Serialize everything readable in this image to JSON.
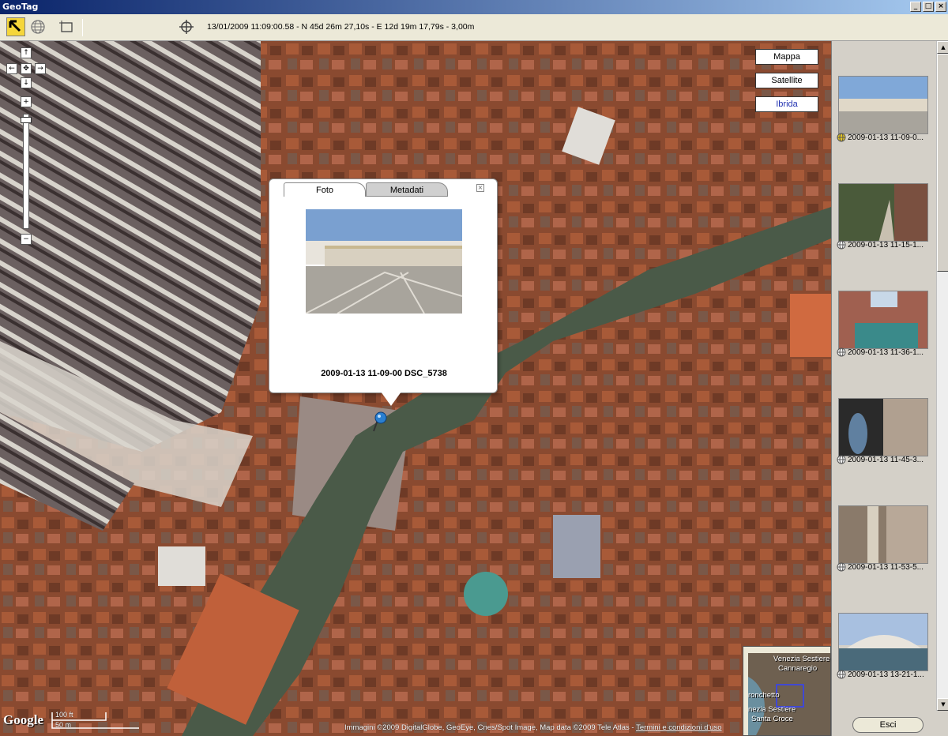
{
  "window": {
    "title": "GeoTag"
  },
  "toolbar": {
    "tools": [
      {
        "name": "select-arrow-icon",
        "active": true
      },
      {
        "name": "globe-icon",
        "active": false
      },
      {
        "name": "frame-icon",
        "active": false
      }
    ],
    "crosshair_icon": "crosshair-icon",
    "coordinates": "13/01/2009 11:09:00.58 - N 45d 26m 27,10s - E 12d 19m 17,79s - 3,00m"
  },
  "map_types": [
    "Mappa",
    "Satellite",
    "Ibrida"
  ],
  "map_type_selected": "Ibrida",
  "popup": {
    "tab_photo": "Foto",
    "tab_metadata": "Metadati",
    "caption": "2009-01-13 11-09-00 DSC_5738"
  },
  "map": {
    "logo": "Google",
    "scale_top": "100 ft",
    "scale_bottom": "50 m",
    "attribution": "Immagini ©2009 DigitalGlobe, GeoEye, Cnes/Spot Image, Map data ©2009 Tele Atlas -",
    "terms_link": "Termini e condizioni d'uso"
  },
  "overview": {
    "label1": "Venezia Sestiere",
    "label2": "Cannaregio",
    "label3": "ronchetto",
    "label4": "nezia Sestiere",
    "label5": "Santa Croce"
  },
  "thumbnails": [
    {
      "label": "2009-01-13 11-09-0..."
    },
    {
      "label": "2009-01-13 11-15-1..."
    },
    {
      "label": "2009-01-13 11-36-1..."
    },
    {
      "label": "2009-01-13 11-45-3..."
    },
    {
      "label": "2009-01-13 11-53-5..."
    },
    {
      "label": "2009-01-13 13-21-1..."
    }
  ],
  "exit_button": "Esci"
}
